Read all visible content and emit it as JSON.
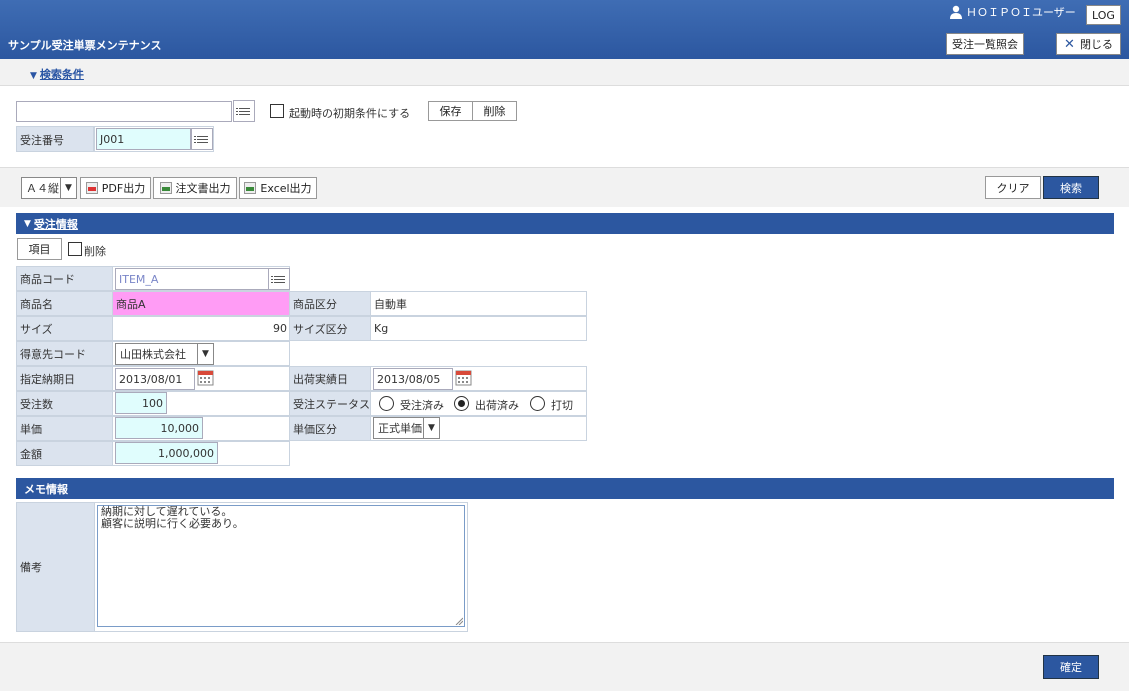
{
  "header": {
    "title": "サンプル受注単票メンテナンス",
    "user": "ＨＯＩＰＯＩユーザー",
    "log_label": "LOG",
    "order_list_label": "受注一覧照会",
    "close_label": "閉じる"
  },
  "search": {
    "toggle_label": "検索条件",
    "preset_value": "",
    "initial_condition_label": "起動時の初期条件にする",
    "save_label": "保存",
    "delete_label": "削除",
    "order_no_label": "受注番号",
    "order_no_value": "J001"
  },
  "toolbar": {
    "paper_size": "Ａ４縦",
    "pdf_label": "PDF出力",
    "order_form_label": "注文書出力",
    "excel_label": "Excel出力",
    "clear_label": "クリア",
    "search_label": "検索"
  },
  "order": {
    "section_label": "受注情報",
    "item_button": "項目",
    "delete_label": "削除",
    "product_code_label": "商品コード",
    "product_code_placeholder": "ITEM_A",
    "product_name_label": "商品名",
    "product_name_value": "商品A",
    "product_class_label": "商品区分",
    "product_class_value": "自動車",
    "size_label": "サイズ",
    "size_value": "90",
    "size_class_label": "サイズ区分",
    "size_class_value": "Kg",
    "customer_code_label": "得意先コード",
    "customer_value": "山田株式会社",
    "due_date_label": "指定納期日",
    "due_date_value": "2013/08/01",
    "ship_date_label": "出荷実績日",
    "ship_date_value": "2013/08/05",
    "qty_label": "受注数",
    "qty_value": "100",
    "status_label": "受注ステータス",
    "status_options": [
      "受注済み",
      "出荷済み",
      "打切"
    ],
    "status_selected": "出荷済み",
    "price_label": "単価",
    "price_value": "10,000",
    "price_class_label": "単価区分",
    "price_class_value": "正式単価",
    "amount_label": "金額",
    "amount_value": "1,000,000"
  },
  "memo": {
    "section_label": "メモ情報",
    "remarks_label": "備考",
    "remarks_line1": "納期に対して遅れている。",
    "remarks_line2": "顧客に説明に行く必要あり。"
  },
  "footer": {
    "confirm_label": "確定"
  },
  "colors": {
    "header_blue": "#2c57a0",
    "label_bg": "#dbe3ee",
    "input_cyan": "#e0fdfd",
    "product_name_pink": "#ff9cf5"
  }
}
